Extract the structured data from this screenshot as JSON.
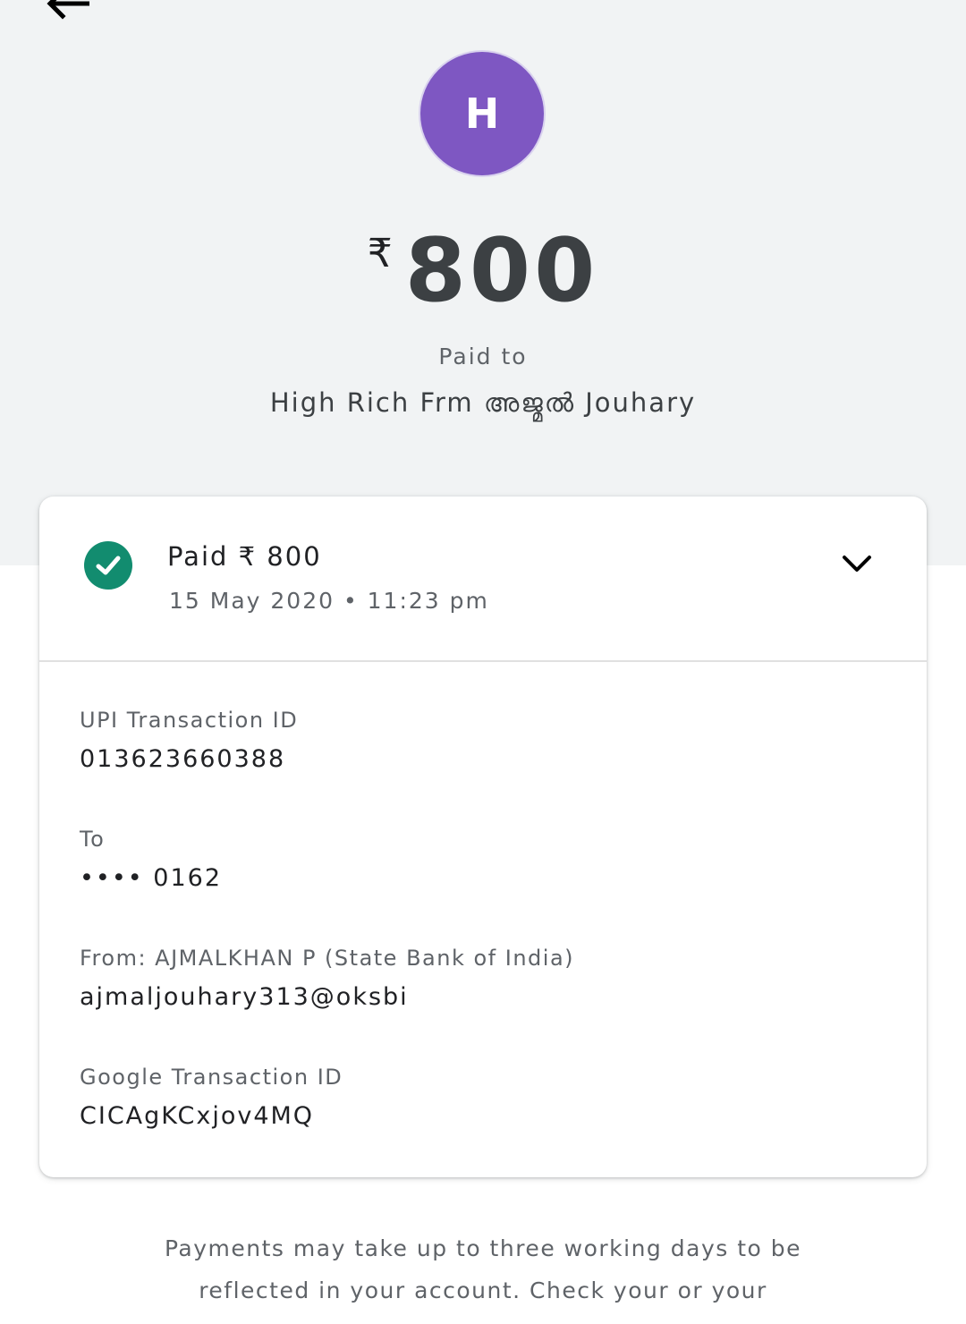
{
  "header": {
    "back_icon": "arrow-left-icon"
  },
  "payee": {
    "avatar_initial": "H",
    "avatar_color": "#7e57c2"
  },
  "amount": {
    "currency_symbol": "₹",
    "value": "800"
  },
  "paid_to": {
    "label": "Paid to",
    "name": "High Rich Frm അജ്മൽ Jouhary"
  },
  "status": {
    "icon": "check-circle-icon",
    "icon_color": "#128c6f",
    "title": "Paid ₹ 800",
    "datetime": "15 May 2020 • 11:23 pm",
    "expand_icon": "chevron-down-icon"
  },
  "details": [
    {
      "label": "UPI Transaction ID",
      "value": "013623660388"
    },
    {
      "label": "To",
      "value": "•••• 0162"
    },
    {
      "label": "From: AJMALKHAN  P (State Bank of India)",
      "value": "ajmaljouhary313@oksbi"
    },
    {
      "label": "Google Transaction ID",
      "value": "CICAgKCxjov4MQ"
    }
  ],
  "footer": {
    "note": "Payments may take up to three working days to be reflected in your account. Check your or your"
  }
}
